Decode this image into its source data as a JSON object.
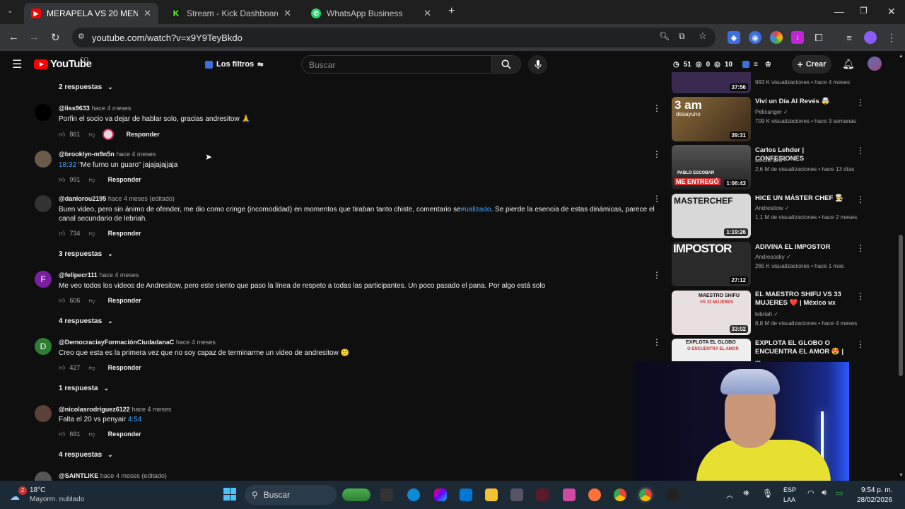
{
  "browser": {
    "tabs": [
      {
        "title": "MERAPELA VS 20 MENTIROSAS",
        "active": true
      },
      {
        "title": "Stream - Kick Dashboard",
        "active": false
      },
      {
        "title": "WhatsApp Business",
        "active": false
      }
    ],
    "url": "youtube.com/watch?v=x9Y9TeyBkdo"
  },
  "youtube": {
    "wordmark": "YouTube",
    "region": "CO",
    "filters_label": "Los filtros",
    "search_placeholder": "Buscar",
    "stats": {
      "a": "51",
      "b": "0",
      "c": "10"
    },
    "create_label": "Crear"
  },
  "comments": {
    "top_replies": "2 respuestas",
    "items": [
      {
        "user": "@liss9633",
        "time": "hace 4 meses",
        "text": "Porfin el socio va dejar de hablar solo, gracias andresitow 🙏",
        "likes": "861",
        "reply": "Responder"
      },
      {
        "user": "@brooklyn-m9n5n",
        "time": "hace 4 meses",
        "timestamp": "18:32",
        "text": " \"Me furno un guaro\" jajajajajjaja",
        "likes": "991",
        "reply": "Responder"
      },
      {
        "user": "@danlorou2195",
        "time": "hace 4 meses (editado)",
        "text_a": "Buen video, pero sin ánimo de ofender, me dio como cringe (incomodidad) en momentos que tiraban tanto chiste, comentario se",
        "hashtag": "#ualizado",
        "text_b": ". Se pierde la esencia de estas dinámicas, parece el canal secundario de lebriah.",
        "likes": "734",
        "reply": "Responder",
        "replies": "3 respuestas"
      },
      {
        "user": "@felipecr111",
        "time": "hace 4 meses",
        "avatar_letter": "F",
        "text": "Me veo todos los videos de Andresitow, pero este siento que paso la línea de respeto a todas las participantes. Un poco pasado el pana. Por algo está solo",
        "likes": "606",
        "reply": "Responder",
        "replies": "4 respuestas"
      },
      {
        "user": "@DemocraciayFormaciónCiudadanaC",
        "time": "hace 4 meses",
        "avatar_letter": "D",
        "text": "Creo que esta es la primera vez que no soy capaz de terminarme un video de andresitow 😕",
        "likes": "427",
        "reply": "Responder",
        "replies": "1 respuesta"
      },
      {
        "user": "@nicolasrodriguez6122",
        "time": "hace 4 meses",
        "text": "Falta el 20 vs penyair ",
        "timestamp": "4:54",
        "likes": "691",
        "reply": "Responder",
        "replies": "4 respuestas"
      },
      {
        "user": "@SAiNTLIKE",
        "time": "hace 4 meses (editado)"
      }
    ]
  },
  "related": [
    {
      "duration": "37:56",
      "meta": "993 K visualizaciones • hace 4 meses",
      "thumb_color": "#3a2a50"
    },
    {
      "title": "Viví un Día Al Revés 🤯",
      "channel": "Pelicanger",
      "duration": "39:31",
      "meta": "709 K visualizaciones • hace 3 semanas",
      "thumb_text": "3 am",
      "thumb_sub": "desayuno",
      "thumb_color": "#6a4a2a"
    },
    {
      "title": "Carlos Lehder | CONFESIONES",
      "channel": "La Liendra",
      "duration": "1:06:43",
      "meta": "2,6 M de visualizaciones • hace 13 días",
      "thumb_text": "ME ENTREGÓ",
      "thumb_sub": "PABLO ESCOBAR",
      "thumb_color": "#444"
    },
    {
      "title": "HICE UN MÁSTER CHEF 👨‍🍳",
      "channel": "Andresitow",
      "duration": "1:19:26",
      "meta": "1,1 M de visualizaciones • hace 2 meses",
      "thumb_text": "MASTERCHEF",
      "thumb_color": "#d8d8d8"
    },
    {
      "title": "ADIVINA EL IMPOSTOR",
      "channel": "Andresosky",
      "duration": "27:12",
      "meta": "265 K visualizaciones • hace 1 mes",
      "thumb_text": "IMPOSTOR",
      "thumb_color": "#2a2a2a"
    },
    {
      "title": "EL MAESTRO SHIFU VS 33 MUJERES ❤️ | México",
      "title_suffix": "MX",
      "channel": "lebriah",
      "duration": "33:02",
      "meta": "8,8 M de visualizaciones • hace 4 meses",
      "thumb_text": "MAESTRO SHIFU",
      "thumb_sub": "VS 33 MUJERES",
      "thumb_color": "#e8e0e0"
    },
    {
      "title": "EXPLOTA EL GLOBO O ENCUENTRA EL AMOR 😍 | ...",
      "thumb_text": "EXPLOTA EL GLOBO",
      "thumb_sub": "O ENCUENTRA EL AMOR",
      "thumb_color": "#eee"
    }
  ],
  "taskbar": {
    "weather_temp": "18°C",
    "weather_desc": "Mayorm. nublado",
    "weather_badge": "2",
    "search_label": "Buscar",
    "lang": "ESP",
    "lang_sub": "LAA",
    "time": "9:54 p. m.",
    "date": "28/02/2026"
  }
}
